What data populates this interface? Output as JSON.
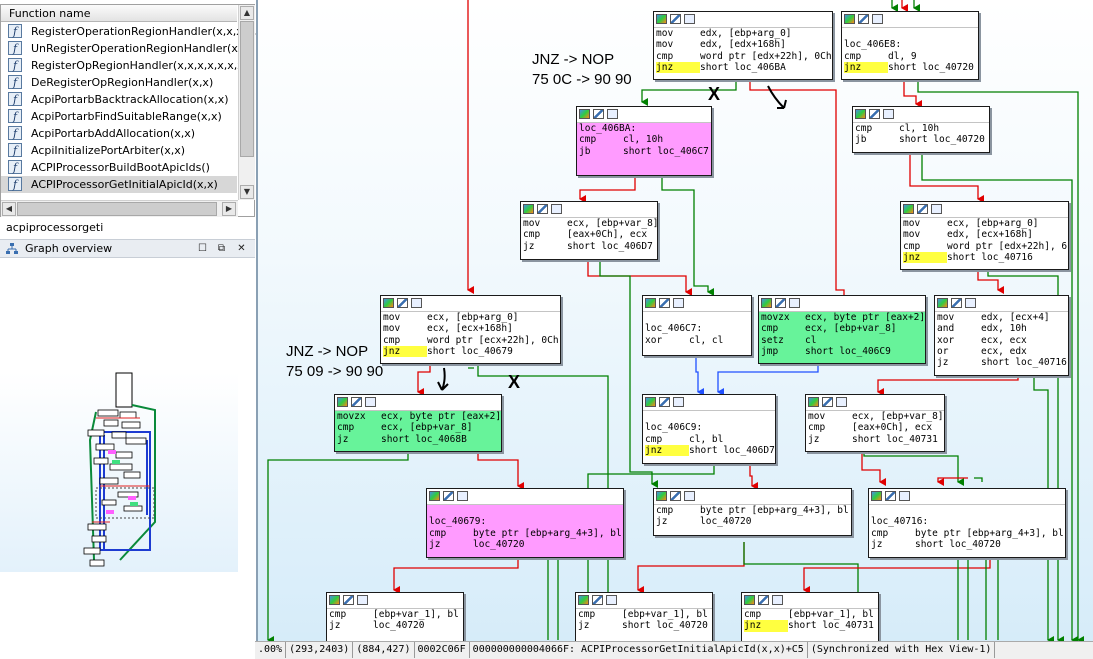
{
  "functions": {
    "header": "Function name",
    "items": [
      "RegisterOperationRegionHandler(x,x,x,x,x,x)",
      "UnRegisterOperationRegionHandler(x,x)",
      "RegisterOpRegionHandler(x,x,x,x,x,x,x)",
      "DeRegisterOpRegionHandler(x,x)",
      "AcpiPortarbBacktrackAllocation(x,x)",
      "AcpiPortarbFindSuitableRange(x,x)",
      "AcpiPortarbAddAllocation(x,x)",
      "AcpiInitializePortArbiter(x,x)",
      "ACPIProcessorBuildBootApicIds()",
      "ACPIProcessorGetInitialApicId(x,x)"
    ],
    "icon_glyph": "f",
    "selected_index": 9
  },
  "search_text": "acpiprocessorgeti",
  "graph_overview": {
    "title": "Graph overview"
  },
  "annotations": {
    "note1_line1": "JNZ -> NOP",
    "note1_line2": "75 0C -> 90 90",
    "note2_line1": "JNZ -> NOP",
    "note2_line2": "75 09 -> 90 90",
    "x_mark": "X"
  },
  "nodes": {
    "n1": [
      [
        "mov",
        "edx, [ebp+arg_0]"
      ],
      [
        "mov",
        "edx, [edx+168h]"
      ],
      [
        "cmp",
        "word ptr [edx+22h], 0Ch"
      ],
      [
        "jnz",
        "short loc_406BA",
        true
      ]
    ],
    "n2": [
      [
        "",
        ""
      ],
      [
        "loc_406E8:",
        ""
      ],
      [
        "cmp",
        "dl, 9"
      ],
      [
        "jnz",
        "short loc_40720",
        true
      ]
    ],
    "n3": [
      [
        "loc_406BA:",
        ""
      ],
      [
        "cmp",
        "cl, 10h"
      ],
      [
        "jb",
        "short loc_406C7"
      ]
    ],
    "n4": [
      [
        "cmp",
        "cl, 10h"
      ],
      [
        "jb",
        "short loc_40720"
      ]
    ],
    "n5": [
      [
        "mov",
        "ecx, [ebp+var_8]"
      ],
      [
        "cmp",
        "[eax+0Ch], ecx"
      ],
      [
        "jz",
        "short loc_406D7"
      ]
    ],
    "n6": [
      [
        "mov",
        "ecx, [ebp+arg_0]"
      ],
      [
        "mov",
        "edx, [ecx+168h]"
      ],
      [
        "cmp",
        "word ptr [edx+22h], 6"
      ],
      [
        "jnz",
        "short loc_40716",
        true
      ]
    ],
    "n7": [
      [
        "mov",
        "ecx, [ebp+arg_0]"
      ],
      [
        "mov",
        "ecx, [ecx+168h]"
      ],
      [
        "cmp",
        "word ptr [ecx+22h], 0Ch"
      ],
      [
        "jnz",
        "short loc_40679",
        true
      ]
    ],
    "n8": [
      [
        "",
        ""
      ],
      [
        "loc_406C7:",
        ""
      ],
      [
        "xor",
        "cl, cl"
      ]
    ],
    "n9": [
      [
        "movzx",
        "ecx, byte ptr [eax+2]"
      ],
      [
        "cmp",
        "ecx, [ebp+var_8]"
      ],
      [
        "setz",
        "cl"
      ],
      [
        "jmp",
        "short loc_406C9"
      ]
    ],
    "n10": [
      [
        "mov",
        "edx, [ecx+4]"
      ],
      [
        "and",
        "edx, 10h"
      ],
      [
        "xor",
        "ecx, ecx"
      ],
      [
        "or",
        "ecx, edx"
      ],
      [
        "jz",
        "short loc_40716"
      ]
    ],
    "n11": [
      [
        "movzx",
        "ecx, byte ptr [eax+2]"
      ],
      [
        "cmp",
        "ecx, [ebp+var_8]"
      ],
      [
        "jz",
        "short loc_4068B"
      ]
    ],
    "n12": [
      [
        "",
        ""
      ],
      [
        "loc_406C9:",
        ""
      ],
      [
        "cmp",
        "cl, bl"
      ],
      [
        "jnz",
        "short loc_406D7",
        true
      ]
    ],
    "n13": [
      [
        "mov",
        "ecx, [ebp+var_8]"
      ],
      [
        "cmp",
        "[eax+0Ch], ecx"
      ],
      [
        "jz",
        "short loc_40731"
      ]
    ],
    "n14": [
      [
        "",
        ""
      ],
      [
        "loc_40679:",
        ""
      ],
      [
        "cmp",
        "byte ptr [ebp+arg_4+3], bl"
      ],
      [
        "jz",
        "loc_40720"
      ]
    ],
    "n15": [
      [
        "cmp",
        "byte ptr [ebp+arg_4+3], bl"
      ],
      [
        "jz",
        "loc_40720"
      ]
    ],
    "n16": [
      [
        "",
        ""
      ],
      [
        "loc_40716:",
        ""
      ],
      [
        "cmp",
        "byte ptr [ebp+arg_4+3], bl"
      ],
      [
        "jz",
        "short loc_40720"
      ]
    ],
    "n17": [
      [
        "cmp",
        "[ebp+var_1], bl"
      ],
      [
        "jz",
        "loc_40720"
      ]
    ],
    "n18": [
      [
        "cmp",
        "[ebp+var_1], bl"
      ],
      [
        "jz",
        "short loc_40720"
      ]
    ],
    "n19": [
      [
        "cmp",
        "[ebp+var_1], bl"
      ],
      [
        "jnz",
        "short loc_40731",
        true
      ]
    ]
  },
  "status": {
    "zoom": ".00%",
    "coords1": "(293,2403)",
    "coords2": "(884,427)",
    "offset": "0002C06F",
    "address": "000000000004066F: ACPIProcessorGetInitialApicId(x,x)+C5",
    "sync": "(Synchronized with Hex View-1)"
  },
  "colors": {
    "pink_block": "#ff9bff",
    "green_block": "#67f39a",
    "true_edge": "#ff0000",
    "false_edge": "#008000",
    "uncond_edge": "#2050ff"
  }
}
